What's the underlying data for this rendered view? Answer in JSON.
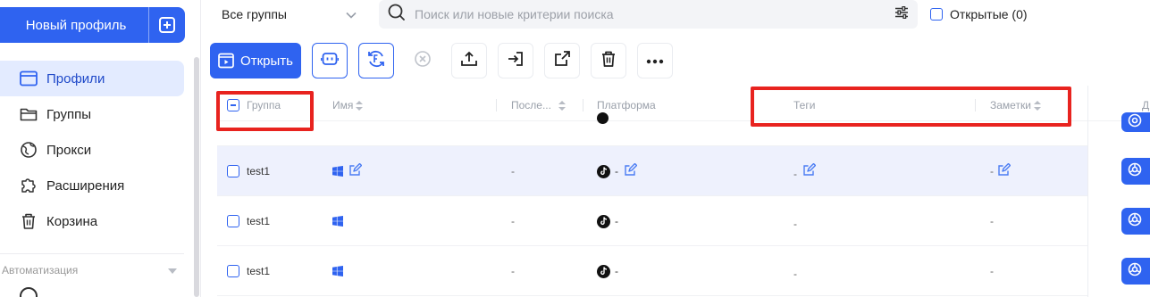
{
  "sidebar": {
    "new_profile_label": "Новый профиль",
    "items": [
      {
        "label": "Профили",
        "icon": "profile-card-icon",
        "active": true
      },
      {
        "label": "Группы",
        "icon": "folder-icon",
        "active": false
      },
      {
        "label": "Прокси",
        "icon": "globe-icon",
        "active": false
      },
      {
        "label": "Расширения",
        "icon": "puzzle-icon",
        "active": false
      },
      {
        "label": "Корзина",
        "icon": "trash-icon",
        "active": false
      }
    ],
    "automation_label": "Автоматизация"
  },
  "topbar": {
    "group_select_value": "Все группы",
    "search_placeholder": "Поиск или новые критерии поиска",
    "opened_label": "Открытые (0)"
  },
  "toolbar": {
    "open_label": "Открыть",
    "buttons": [
      "robot-icon",
      "sync-icon",
      "close-circle-icon",
      "upload-icon",
      "import-icon",
      "share-icon",
      "trash-icon",
      "more-icon"
    ]
  },
  "table": {
    "columns": {
      "group": "Группа",
      "name": "Имя",
      "last": "После...",
      "platform": "Платформа",
      "tags": "Теги",
      "notes": "Заметки",
      "right_fragment": "Д"
    },
    "rows": [
      {
        "group": "test1",
        "last": "-",
        "platform_dash": "-",
        "tags": "-",
        "notes": "-",
        "selected": true
      },
      {
        "group": "test1",
        "last": "-",
        "platform_dash": "-",
        "tags": "-",
        "notes": "-",
        "selected": false
      },
      {
        "group": "test1",
        "last": "-",
        "platform_dash": "-",
        "tags": "-",
        "notes": "-",
        "selected": false
      }
    ]
  },
  "colors": {
    "accent": "#2f63f0",
    "active_nav_bg": "#e3ebff",
    "selected_row_bg": "#eef1fd",
    "highlight_red": "#e8231f"
  }
}
